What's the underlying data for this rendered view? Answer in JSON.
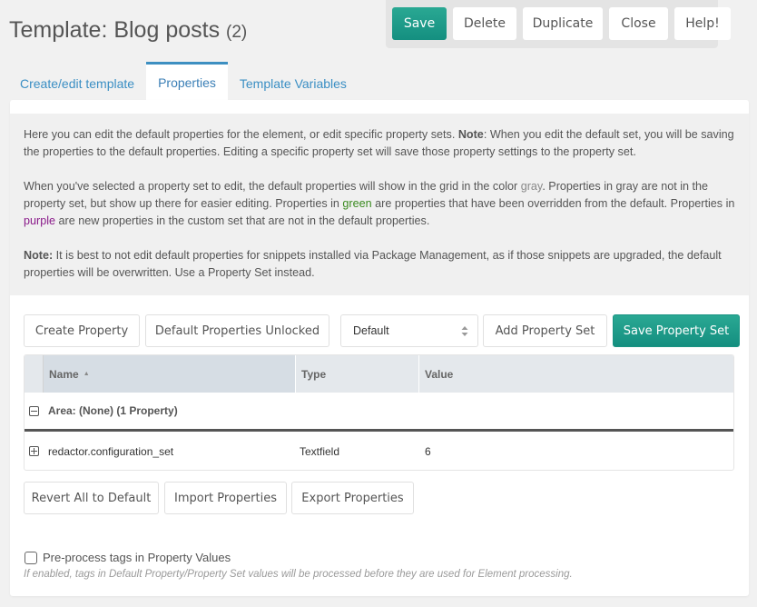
{
  "header": {
    "title": "Template: Blog posts",
    "count": "(2)"
  },
  "toolbar": {
    "save": "Save",
    "delete": "Delete",
    "duplicate": "Duplicate",
    "close": "Close",
    "help": "Help!"
  },
  "tabs": [
    {
      "label": "Create/edit template",
      "active": false
    },
    {
      "label": "Properties",
      "active": true
    },
    {
      "label": "Template Variables",
      "active": false
    }
  ],
  "intro": {
    "p1_a": "Here you can edit the default properties for the element, or edit specific property sets. ",
    "p1_bold": "Note",
    "p1_b": ": When you edit the default set, you will be saving the properties to the default properties. Editing a specific property set will save those property settings to the property set.",
    "p2_a": "When you've selected a property set to edit, the default properties will show in the grid in the color ",
    "p2_gray": "gray",
    "p2_b": ". Properties in gray are not in the property set, but show up there for easier editing. Properties in ",
    "p2_green": "green",
    "p2_c": " are properties that have been overridden from the default. Properties in ",
    "p2_purple": "purple",
    "p2_d": " are new properties in the custom set that are not in the default properties.",
    "p3_bold": "Note:",
    "p3_a": " It is best to not edit default properties for snippets installed via Package Management, as if those snippets are upgraded, the default properties will be overwritten. Use a Property Set instead."
  },
  "actions": {
    "create_property": "Create Property",
    "default_unlocked": "Default Properties Unlocked",
    "property_set_select": "Default",
    "add_property_set": "Add Property Set",
    "save_property_set": "Save Property Set"
  },
  "grid": {
    "columns": [
      "Name",
      "Type",
      "Value"
    ],
    "sort_indicator": "▲",
    "group": "Area: (None) (1 Property)",
    "rows": [
      {
        "name": "redactor.configuration_set",
        "type": "Textfield",
        "value": "6"
      }
    ]
  },
  "bottom_actions": {
    "revert": "Revert All to Default",
    "import": "Import Properties",
    "export": "Export Properties"
  },
  "preprocess": {
    "label": "Pre-process tags in Property Values",
    "checked": false,
    "help": "If enabled, tags in Default Property/Property Set values will be processed before they are used for Element processing."
  },
  "colors": {
    "accent": "#1a9a88",
    "tab_active": "#3d8fc1",
    "link": "#3b8fc4",
    "gray": "#888888",
    "green": "#3a8a1f",
    "purple": "#8a1a8a"
  }
}
